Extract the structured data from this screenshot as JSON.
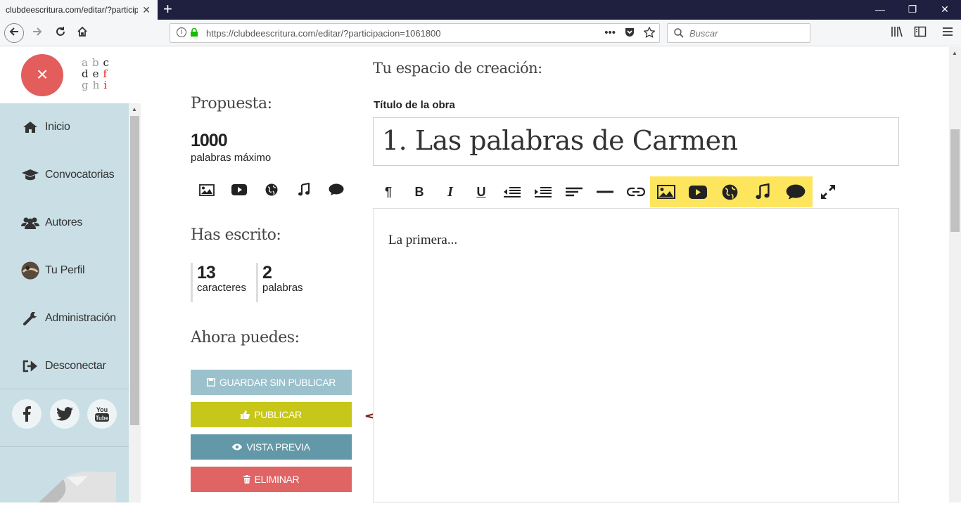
{
  "browser": {
    "tab_title": "clubdeescritura.com/editar/?particip",
    "tab_close": "✕",
    "new_tab": "+",
    "url": "https://clubdeescritura.com/editar/?participacion=1061800",
    "search_placeholder": "Buscar",
    "window": {
      "minimize": "—",
      "restore": "❐",
      "close": "✕"
    }
  },
  "sidebar": {
    "close_symbol": "×",
    "logo": {
      "row1": "abc",
      "row2": "def",
      "row3": "ghi"
    },
    "items": [
      {
        "label": "Inicio",
        "icon": "home-icon"
      },
      {
        "label": "Convocatorias",
        "icon": "graduation-cap-icon"
      },
      {
        "label": "Autores",
        "icon": "users-icon"
      },
      {
        "label": "Tu Perfil",
        "icon": "avatar"
      },
      {
        "label": "Administración",
        "icon": "wrench-icon"
      },
      {
        "label": "Desconectar",
        "icon": "sign-out-icon"
      }
    ],
    "social": [
      "facebook-icon",
      "twitter-icon",
      "youtube-icon"
    ]
  },
  "proposal": {
    "heading": "Propuesta:",
    "max_words": "1000",
    "max_words_label": "palabras máximo"
  },
  "written": {
    "heading": "Has escrito:",
    "chars": "13",
    "chars_label": "caracteres",
    "words": "2",
    "words_label": "palabras"
  },
  "actions": {
    "heading": "Ahora puedes:",
    "save": "GUARDAR SIN PUBLICAR",
    "publish": "PUBLICAR",
    "preview": "VISTA PREVIA",
    "delete": "ELIMINAR",
    "colors": {
      "save": "#9bc1cc",
      "publish": "#c7c71a",
      "preview": "#6398a8",
      "delete": "#e06464"
    }
  },
  "editor": {
    "heading": "Tu espacio de creación:",
    "title_label": "Título de la obra",
    "title_value": "1. Las palabras de Carmen",
    "body_text": "La primera...",
    "media_highlight": "#fde55e"
  }
}
